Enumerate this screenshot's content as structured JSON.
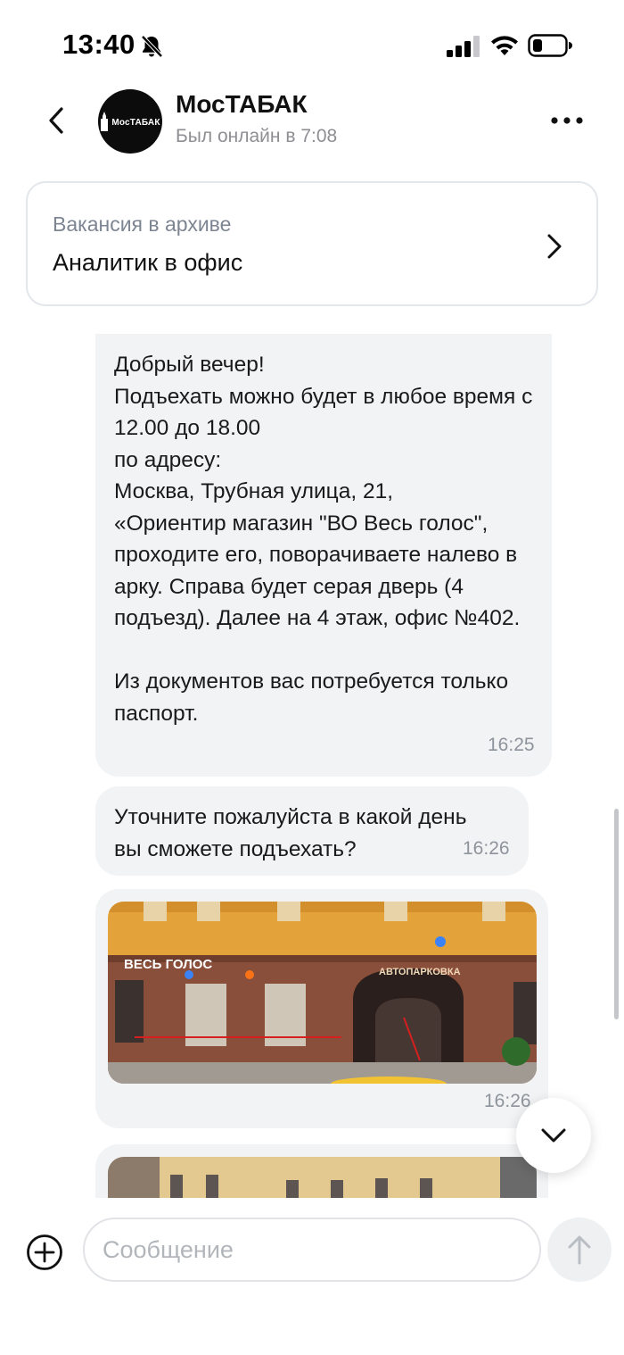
{
  "status_bar": {
    "time": "13:40",
    "icons": [
      "bell-slash-icon",
      "cellular-signal-icon",
      "wifi-icon",
      "battery-icon"
    ]
  },
  "header": {
    "back_icon": "chevron-left-icon",
    "avatar_text": "МосТАБАК",
    "contact_name": "МосТАБАК",
    "contact_status": "Был онлайн в 7:08",
    "more_icon": "more-horizontal-icon"
  },
  "vacancy": {
    "label": "Вакансия в архиве",
    "title": "Аналитик в офис",
    "icon": "chevron-right-icon"
  },
  "messages": [
    {
      "text": "Добрый вечер!\nПодъехать можно будет в любое время с 12.00 до 18.00\nпо адресу:\nМосква, Трубная улица, 21,\n«Ориентир магазин \"ВО Весь голос\", проходите его, поворачиваете налево в арку. Справа будет серая дверь (4 подъезд). Далее на 4 этаж, офис №402.\n\nИз документов вас потребуется только паспорт.",
      "time": "16:25"
    },
    {
      "text": "Уточните пожалуйста в какой день вы сможете подъехать?",
      "time": "16:26"
    },
    {
      "type": "photo",
      "sign_left": "ВЕСЬ ГОЛОС",
      "sign_right": "АВТОПАРКОВКА",
      "time": "16:26"
    },
    {
      "type": "photo"
    }
  ],
  "composer": {
    "placeholder": "Сообщение",
    "add_icon": "plus-circle-icon",
    "send_icon": "arrow-up-icon"
  },
  "colors": {
    "bubble_bg": "#f2f3f5",
    "secondary_text": "#8e8e93",
    "border": "#e3e6ea"
  }
}
